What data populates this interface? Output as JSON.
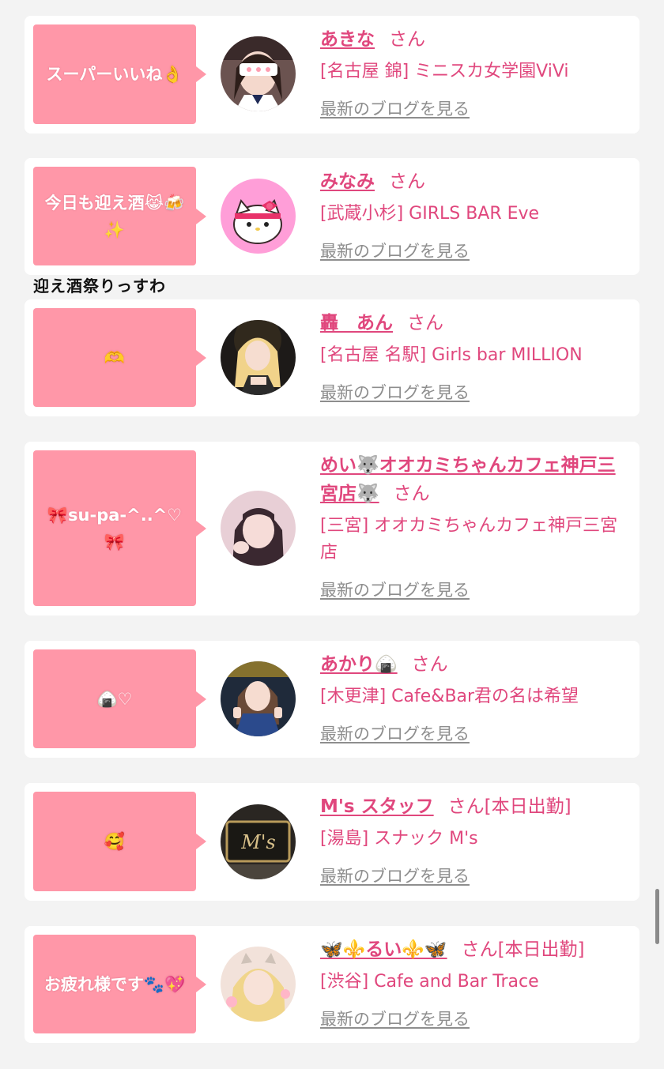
{
  "common": {
    "san": "さん",
    "blog_link": "最新のブログを見る"
  },
  "overlay_caption": "迎え酒祭りっすわ",
  "posts": [
    {
      "bubble": "スーパーいいね👌",
      "name": "あきな",
      "status": "",
      "shop": "[名古屋 錦] ミニスカ女学園ViVi"
    },
    {
      "bubble": "今日も迎え酒😹🍻✨",
      "name": "みなみ",
      "status": "",
      "shop": "[武蔵小杉] GIRLS BAR Eve"
    },
    {
      "bubble": "🫶",
      "name": "轟　あん",
      "status": "",
      "shop": "[名古屋 名駅] Girls bar MILLION"
    },
    {
      "bubble": "🎀su-pa-^..^♡🎀",
      "name": "めい🐺オオカミちゃんカフェ神戸三宮店🐺",
      "status": "",
      "shop": "[三宮] オオカミちゃんカフェ神戸三宮店"
    },
    {
      "bubble": "🍙♡",
      "name": "あかり🍙",
      "status": "",
      "shop": "[木更津] Cafe&Bar君の名は希望"
    },
    {
      "bubble": "🥰",
      "name": "M's スタッフ",
      "status": "[本日出勤]",
      "shop": "[湯島] スナック M's"
    },
    {
      "bubble": "お疲れ様です🐾💖",
      "name": "🦋⚜️るい⚜️🦋",
      "status": "[本日出勤]",
      "shop": "[渋谷] Cafe and Bar Trace"
    }
  ],
  "icons": {
    "avatar_0": "avatar-photo-icon",
    "avatar_1": "kitty-character-icon",
    "avatar_2": "avatar-photo-icon",
    "avatar_3": "avatar-photo-icon",
    "avatar_4": "avatar-photo-icon",
    "avatar_5": "shop-sign-icon",
    "avatar_6": "avatar-photo-icon"
  },
  "colors": {
    "accent": "#e0477d",
    "bubble": "#ff97a8",
    "link_gray": "#8e8e8e",
    "background": "#f3f3f3"
  }
}
